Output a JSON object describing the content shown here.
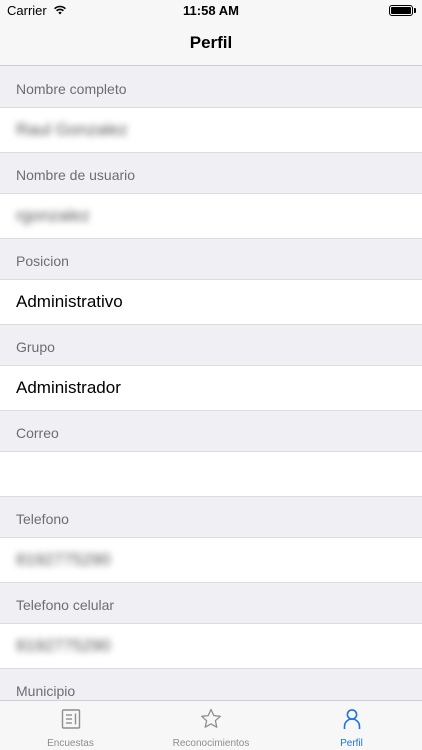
{
  "status_bar": {
    "carrier": "Carrier",
    "time": "11:58 AM"
  },
  "nav": {
    "title": "Perfil"
  },
  "fields": [
    {
      "label": "Nombre completo",
      "value": "Raul Gonzalez",
      "obscured": true
    },
    {
      "label": "Nombre de usuario",
      "value": "rgonzalez",
      "obscured": true
    },
    {
      "label": "Posicion",
      "value": "Administrativo",
      "obscured": false
    },
    {
      "label": "Grupo",
      "value": "Administrador",
      "obscured": false
    },
    {
      "label": "Correo",
      "value": "",
      "obscured": false
    },
    {
      "label": "Telefono",
      "value": "8192775290",
      "obscured": true
    },
    {
      "label": "Telefono celular",
      "value": "8192775290",
      "obscured": true
    },
    {
      "label": "Municipio",
      "value": "",
      "obscured": false
    }
  ],
  "tabs": [
    {
      "label": "Encuestas",
      "icon": "list-icon",
      "active": false
    },
    {
      "label": "Reconocimientos",
      "icon": "star-icon",
      "active": false
    },
    {
      "label": "Perfil",
      "icon": "person-icon",
      "active": true
    }
  ],
  "colors": {
    "accent": "#1a73e8",
    "background": "#efeff4",
    "label": "#6d6d72",
    "inactive": "#8e8e93"
  }
}
